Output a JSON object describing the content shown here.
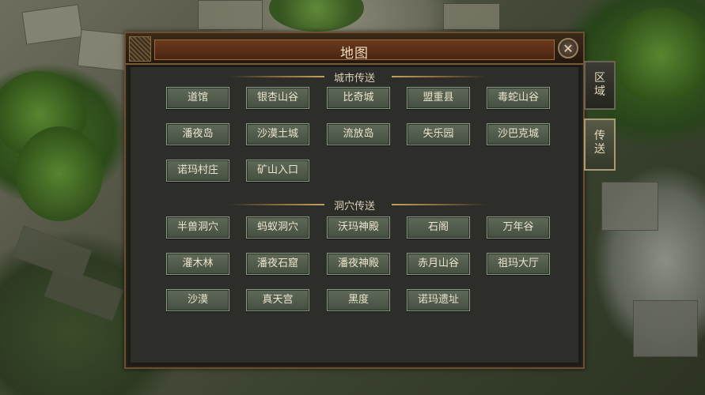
{
  "window": {
    "title": "地图",
    "close_icon": "close-x-icon"
  },
  "tabs": [
    {
      "label": "区\n域",
      "active": false
    },
    {
      "label": "传\n送",
      "active": true
    }
  ],
  "city_section": {
    "title": "城市传送",
    "buttons": [
      "道馆",
      "银杏山谷",
      "比奇城",
      "盟重县",
      "毒蛇山谷",
      "潘夜岛",
      "沙漠土城",
      "流放岛",
      "失乐园",
      "沙巴克城",
      "诺玛村庄",
      "矿山入口"
    ]
  },
  "cave_section": {
    "title": "洞穴传送",
    "buttons": [
      "半兽洞穴",
      "蚂蚁洞穴",
      "沃玛神殿",
      "石阁",
      "万年谷",
      "灌木林",
      "潘夜石窟",
      "潘夜神殿",
      "赤月山谷",
      "祖玛大厅",
      "沙漠",
      "真天宫",
      "黑度",
      "诺玛遗址"
    ]
  }
}
